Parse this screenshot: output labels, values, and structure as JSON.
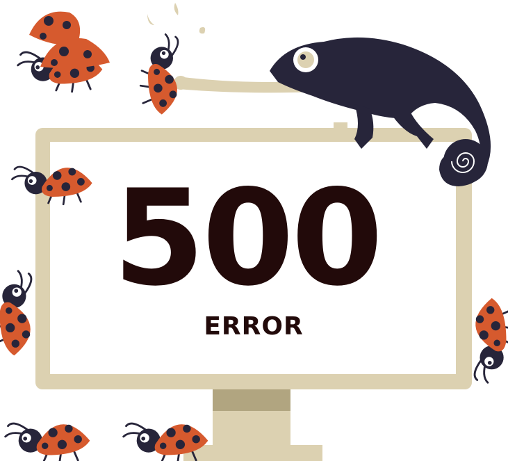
{
  "error": {
    "code": "500",
    "label": "ERROR"
  },
  "colors": {
    "monitor_frame": "#dcd1b1",
    "monitor_stand_shadow": "#b1a580",
    "screen": "#ffffff",
    "text": "#220a0a",
    "chameleon": "#27253a",
    "tongue": "#dcd1b1",
    "ladybug_shell": "#d65a2e",
    "ladybug_body": "#27253a"
  },
  "illustration": {
    "monitor": "monitor-icon",
    "chameleon": "chameleon-icon",
    "ladybugs": [
      "ladybug-icon",
      "ladybug-icon",
      "ladybug-icon",
      "ladybug-icon",
      "ladybug-icon",
      "ladybug-icon",
      "ladybug-icon",
      "ladybug-icon"
    ]
  }
}
